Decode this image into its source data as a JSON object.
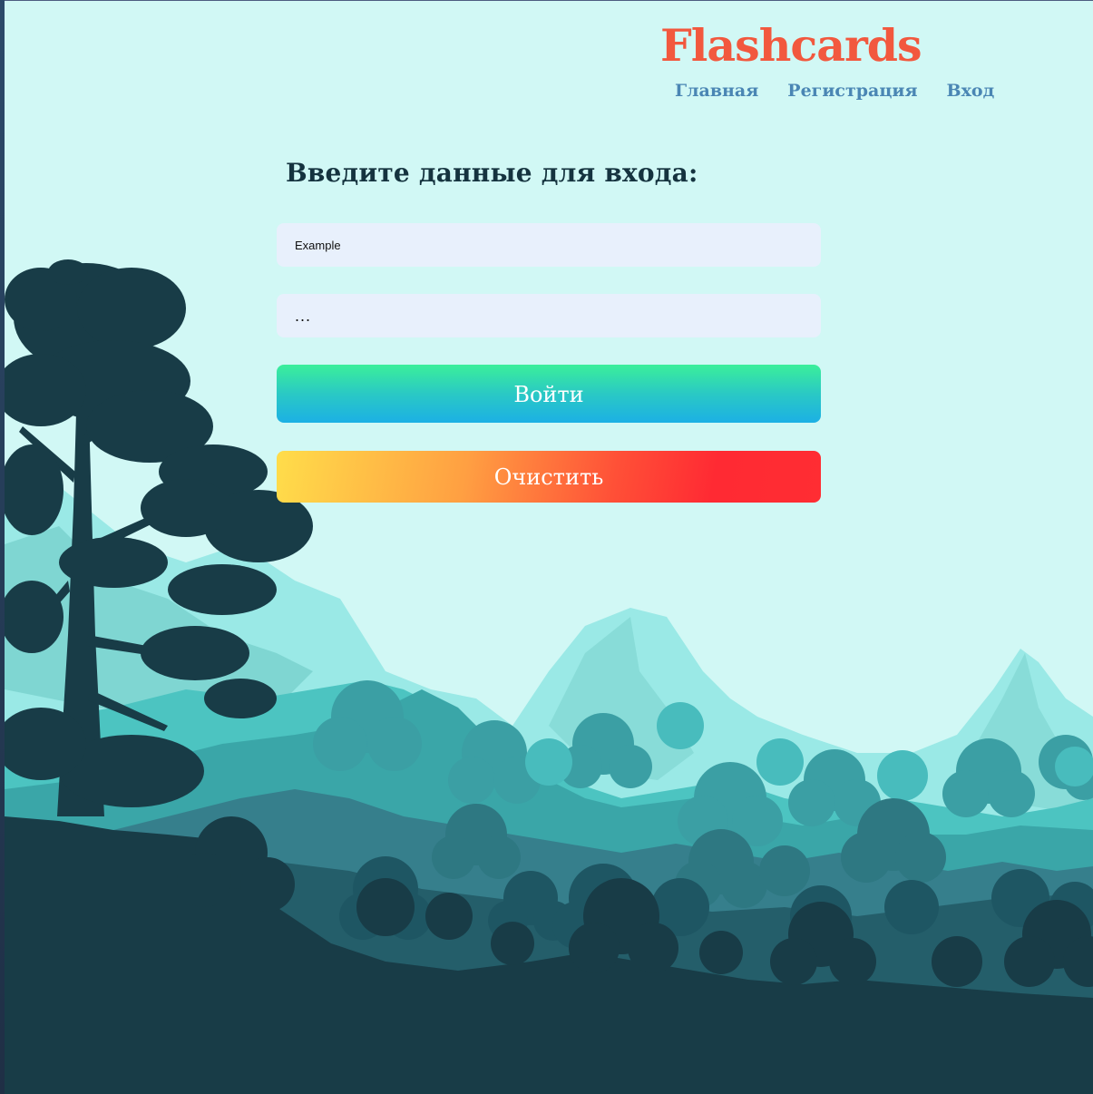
{
  "app": {
    "title": "Flashcards"
  },
  "nav": {
    "items": [
      {
        "label": "Главная"
      },
      {
        "label": "Регистрация"
      },
      {
        "label": "Вход"
      }
    ]
  },
  "login_form": {
    "heading": "Введите данные для входа:",
    "login_value": "Example",
    "password_value": "...",
    "submit_label": "Войти",
    "clear_label": "Очистить"
  },
  "colors": {
    "background": "#d1f8f5",
    "logo": "#f2583e",
    "nav_link": "#4a86b4",
    "heading": "#15333f",
    "input_bg": "#e8f0fc",
    "forest_dark": "#183c47"
  }
}
